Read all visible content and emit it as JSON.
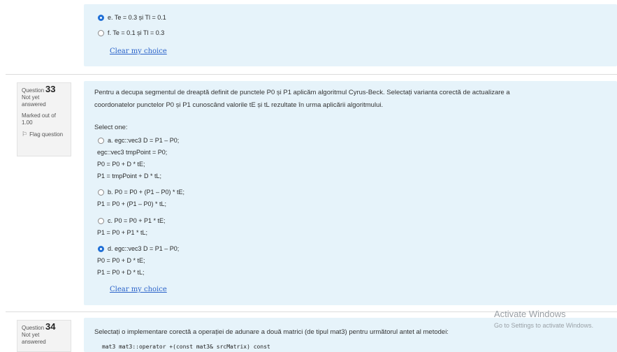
{
  "prev_question": {
    "options": [
      {
        "text": "e. Te = 0.3 și Tl = 0.1",
        "checked": true
      },
      {
        "text": "f. Te = 0.1 și Tl = 0.3",
        "checked": false
      }
    ],
    "clear_label": "Clear my choice"
  },
  "q33": {
    "info": {
      "label": "Question",
      "number": "33",
      "status_1": "Not yet",
      "status_2": "answered",
      "marked_1": "Marked out of",
      "marked_2": "1.00",
      "flag_label": "Flag question"
    },
    "text_1": "Pentru a decupa segmentul de dreaptă definit de punctele P0 și P1 aplicăm algoritmul Cyrus-Beck. Selectați varianta corectă de actualizare a",
    "text_2": "coordonatelor punctelor P0 și P1 cunoscând valorile tE și tL rezultate în urma aplicării algoritmului.",
    "select_one": "Select one:",
    "options": [
      {
        "lines": [
          "a. egc::vec3 D = P1 – P0;",
          "egc::vec3 tmpPoint = P0;",
          "P0 = P0 + D * tE;",
          "P1 = tmpPoint + D * tL;"
        ],
        "checked": false
      },
      {
        "lines": [
          "b. P0 = P0 + (P1 – P0) * tE;",
          "P1 = P0 + (P1 – P0) * tL;"
        ],
        "checked": false
      },
      {
        "lines": [
          "c. P0 = P0 + P1 * tE;",
          "P1 = P0 + P1 * tL;"
        ],
        "checked": false
      },
      {
        "lines": [
          "d. egc::vec3 D = P1 – P0;",
          "P0 = P0 + D * tE;",
          "P1 = P0 + D * tL;"
        ],
        "checked": true
      }
    ],
    "clear_label": "Clear my choice"
  },
  "q34": {
    "info": {
      "label": "Question",
      "number": "34",
      "status_1": "Not yet",
      "status_2": "answered"
    },
    "text": "Selectați o implementare corectă a operației de adunare a două matrici (de tipul mat3) pentru următorul antet al metodei:",
    "code": "mat3 mat3::operator +(const mat3& srcMatrix) const"
  },
  "watermark": {
    "title": "Activate Windows",
    "subtitle": "Go to Settings to activate Windows."
  },
  "colors": {
    "panel_bg": "#e6f3fa",
    "link": "#2a62c9",
    "radio_checked": "#1f6fd6"
  }
}
